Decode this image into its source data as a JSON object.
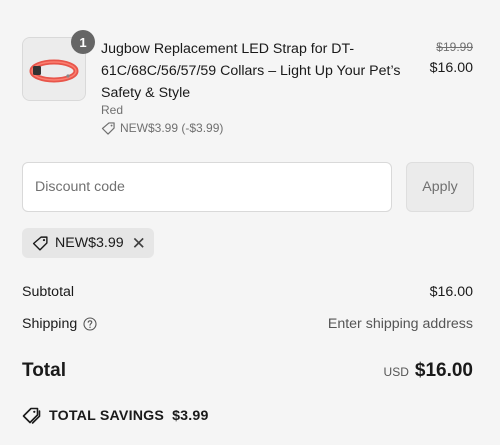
{
  "line_item": {
    "quantity": "1",
    "title": "Jugbow Replacement LED Strap for DT-61C/68C/56/57/59 Collars – Light Up Your Pet’s Safety & Style",
    "variant": "Red",
    "discount": "NEW$3.99 (-$3.99)",
    "original_price": "$19.99",
    "price": "$16.00"
  },
  "discount_form": {
    "placeholder": "Discount code",
    "apply_label": "Apply"
  },
  "applied_code": {
    "code": "NEW$3.99"
  },
  "summary": {
    "subtotal_label": "Subtotal",
    "subtotal_value": "$16.00",
    "shipping_label": "Shipping",
    "shipping_value": "Enter shipping address",
    "total_label": "Total",
    "currency": "USD",
    "total_value": "$16.00",
    "savings_label": "TOTAL SAVINGS",
    "savings_value": "$3.99"
  },
  "icons": {
    "tag": "tag-icon",
    "help": "help-circle-icon",
    "remove": "close-icon",
    "savings": "double-tag-icon"
  },
  "colors": {
    "text": "#1a1a1a",
    "muted": "#707070",
    "background": "#f5f5f5",
    "product_strap": "#e8554a"
  }
}
